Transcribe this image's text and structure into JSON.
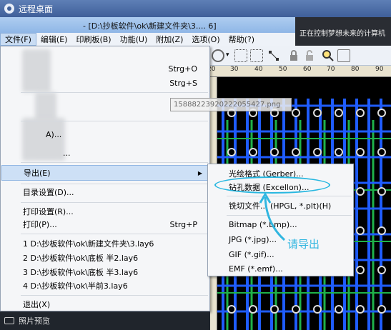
{
  "remote_window": {
    "title": "远程桌面"
  },
  "app": {
    "title": "- [D:\\抄板软件\\ok\\新建文件夹\\3.... 6]"
  },
  "remote_banner": "正在控制梦想未来的计算机",
  "menubar": {
    "items": [
      "文件(F)",
      "编辑(E)",
      "印刷板(B)",
      "功能(U)",
      "附加(Z)",
      "选项(O)",
      "帮助(?)"
    ]
  },
  "ruler": {
    "ticks": [
      "20",
      "30",
      "40",
      "50",
      "60",
      "70",
      "80",
      "90"
    ]
  },
  "file_menu": {
    "shortcut_open": "Strg+O",
    "shortcut_save": "Strg+S",
    "partial_label": "A)...",
    "export": "导出(E)",
    "directory_settings": "目录设置(D)...",
    "print_settings": "打印设置(R)...",
    "print": "打印(P)...",
    "print_shortcut": "Strg+P",
    "recent_files": [
      "1 D:\\抄板软件\\ok\\新建文件夹\\3.lay6",
      "2 D:\\抄板软件\\ok\\底板 半2.lay6",
      "3 D:\\抄板软件\\ok\\底板 半3.lay6",
      "4 D:\\抄板软件\\ok\\半前3.lay6"
    ],
    "exit": "退出(X)"
  },
  "overlay_text": "15888223920222055427.png",
  "export_submenu": {
    "items": [
      "光绘格式 (Gerber)...",
      "钻孔数据 (Excellon)...",
      "铣切文件... (HPGL, *.plt)(H)",
      "Bitmap (*.bmp)...",
      "JPG (*.jpg)...",
      "GIF (*.gif)...",
      "EMF (*.emf)..."
    ]
  },
  "annotation": {
    "text": "请导出",
    "color": "#31b6e0"
  },
  "statusbar": {
    "label": "照片预览"
  },
  "colors": {
    "trace_blue": "#1f5cff",
    "trace_green": "#1fb24a",
    "pad": "#dcdcdc"
  }
}
